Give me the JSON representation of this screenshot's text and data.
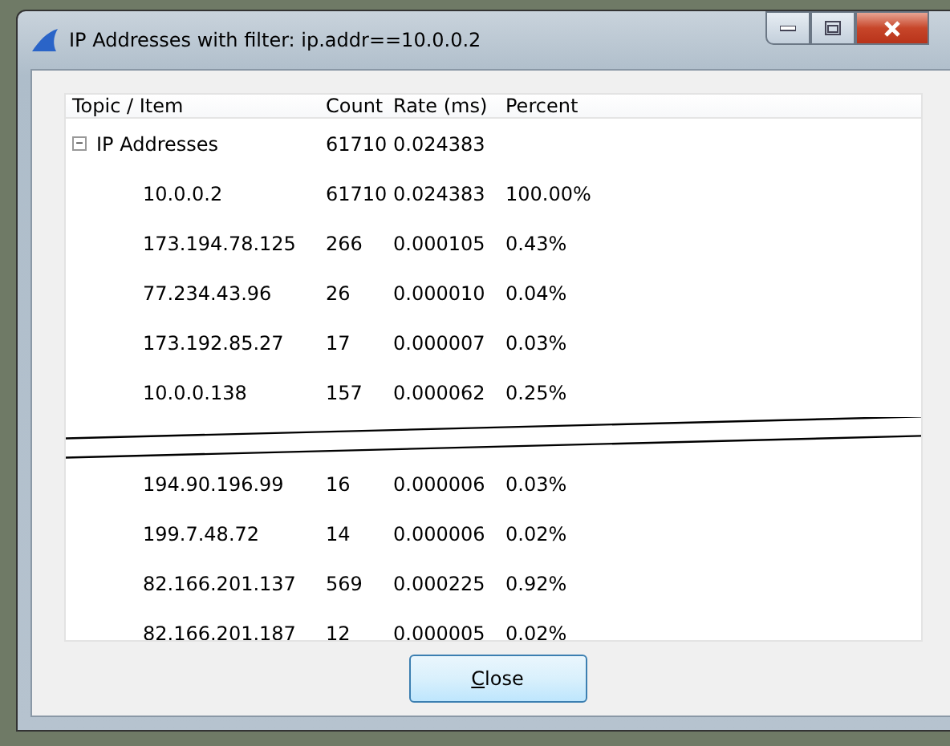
{
  "window": {
    "title": "IP Addresses with filter: ip.addr==10.0.0.2"
  },
  "table": {
    "columns": [
      "Topic / Item",
      "Count",
      "Rate (ms)",
      "Percent"
    ],
    "rows": [
      {
        "kind": "row",
        "topic": "IP Addresses",
        "count": "61710",
        "rate": "0.024383",
        "expanded": true,
        "children": [
          {
            "kind": "row",
            "topic": "10.0.0.2",
            "count": "61710",
            "rate": "0.024383",
            "percent": "100.00%"
          },
          {
            "kind": "row",
            "topic": "173.194.78.125",
            "count": "266",
            "rate": "0.000105",
            "percent": "0.43%"
          },
          {
            "kind": "row",
            "topic": "77.234.43.96",
            "count": "26",
            "rate": "0.000010",
            "percent": "0.04%"
          },
          {
            "kind": "row",
            "topic": "173.192.85.27",
            "count": "17",
            "rate": "0.000007",
            "percent": "0.03%"
          },
          {
            "kind": "row",
            "topic": "10.0.0.138",
            "count": "157",
            "rate": "0.000062",
            "percent": "0.25%"
          },
          {
            "kind": "tear"
          },
          {
            "kind": "row",
            "topic": "194.90.196.99",
            "count": "16",
            "rate": "0.000006",
            "percent": "0.03%"
          },
          {
            "kind": "row",
            "topic": "199.7.48.72",
            "count": "14",
            "rate": "0.000006",
            "percent": "0.02%"
          },
          {
            "kind": "row",
            "topic": "82.166.201.137",
            "count": "569",
            "rate": "0.000225",
            "percent": "0.92%"
          },
          {
            "kind": "row",
            "topic": "82.166.201.187",
            "count": "12",
            "rate": "0.000005",
            "percent": "0.02%"
          }
        ]
      }
    ]
  },
  "buttons": [
    {
      "label": "Close",
      "mnemonic_underlined": true
    }
  ]
}
